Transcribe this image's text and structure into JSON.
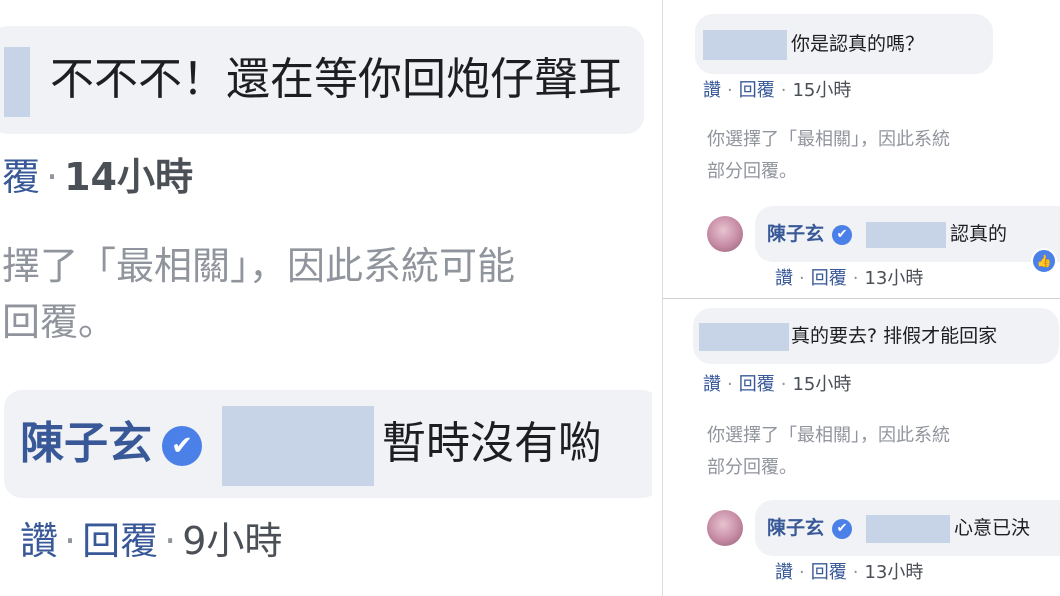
{
  "left": {
    "comment1": {
      "text": "不不不！還在等你回炮仔聲耳"
    },
    "meta1": {
      "reply": "覆",
      "dot": "·",
      "time": "14小時"
    },
    "notice": {
      "line1": "擇了「最相關」，因此系統可能",
      "line2": "回覆。"
    },
    "reply": {
      "name": "陳子玄",
      "verified_icon": "✔",
      "text": "暫時沒有喲"
    },
    "meta2": {
      "like": "讚",
      "dot": "·",
      "reply": "回覆",
      "time": "9小時"
    }
  },
  "right": {
    "comment1": {
      "text": "你是認真的嗎？"
    },
    "meta1": {
      "like": "讚",
      "dot": "·",
      "reply": "回覆",
      "time": "15小時"
    },
    "notice1": {
      "line1": "你選擇了「最相關」，因此系統",
      "line2": "部分回覆。"
    },
    "reply1": {
      "name": "陳子玄",
      "verified_icon": "✔",
      "text": "認真的",
      "like_icon": "👍"
    },
    "meta2": {
      "like": "讚",
      "dot": "·",
      "reply": "回覆",
      "time": "13小時"
    },
    "comment2": {
      "text": "真的要去? 排假才能回家"
    },
    "meta3": {
      "like": "讚",
      "dot": "·",
      "reply": "回覆",
      "time": "15小時"
    },
    "notice2": {
      "line1": "你選擇了「最相關」，因此系統",
      "line2": "部分回覆。"
    },
    "reply2": {
      "name": "陳子玄",
      "verified_icon": "✔",
      "text": "心意已決"
    },
    "meta4": {
      "like": "讚",
      "dot": "·",
      "reply": "回覆",
      "time": "13小時"
    }
  }
}
